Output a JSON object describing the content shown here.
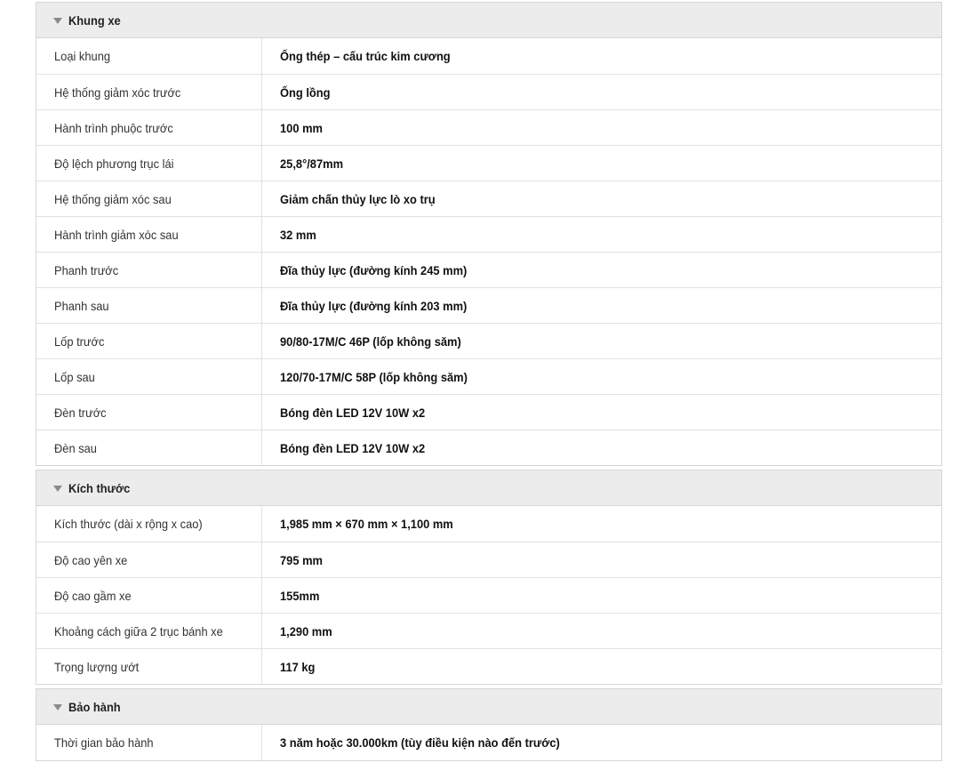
{
  "sections": [
    {
      "title": "Khung xe",
      "rows": [
        {
          "label": "Loại khung",
          "value": "Ống thép – cấu trúc kim cương"
        },
        {
          "label": "Hệ thống giảm xóc trước",
          "value": "Ống lồng"
        },
        {
          "label": "Hành trình phuộc trước",
          "value": "100 mm"
        },
        {
          "label": "Độ lệch phương trục lái",
          "value": "25,8°/87mm"
        },
        {
          "label": "Hệ thống giảm xóc sau",
          "value": "Giảm chấn thủy lực lò xo trụ"
        },
        {
          "label": "Hành trình giảm xóc sau",
          "value": "32 mm"
        },
        {
          "label": "Phanh trước",
          "value": "Đĩa thủy lực (đường kính 245 mm)"
        },
        {
          "label": "Phanh sau",
          "value": "Đĩa thủy lực (đường kính 203 mm)"
        },
        {
          "label": "Lốp trước",
          "value": "90/80-17M/C 46P (lốp không săm)"
        },
        {
          "label": "Lốp sau",
          "value": "120/70-17M/C 58P (lốp không săm)"
        },
        {
          "label": "Đèn trước",
          "value": "Bóng đèn LED 12V 10W x2"
        },
        {
          "label": "Đèn sau",
          "value": "Bóng đèn LED 12V 10W x2"
        }
      ]
    },
    {
      "title": "Kích thước",
      "rows": [
        {
          "label": "Kích thước (dài x rộng x cao)",
          "value": "1,985 mm × 670 mm × 1,100 mm"
        },
        {
          "label": "Độ cao yên xe",
          "value": "795 mm"
        },
        {
          "label": "Độ cao gầm xe",
          "value": "155mm"
        },
        {
          "label": "Khoảng cách giữa 2 trục bánh xe",
          "value": "1,290 mm"
        },
        {
          "label": "Trọng lượng ướt",
          "value": "117 kg"
        }
      ]
    },
    {
      "title": "Bảo hành",
      "rows": [
        {
          "label": "Thời gian bảo hành",
          "value": "3 năm hoặc 30.000km (tùy điều kiện nào đến trước)"
        }
      ]
    }
  ]
}
